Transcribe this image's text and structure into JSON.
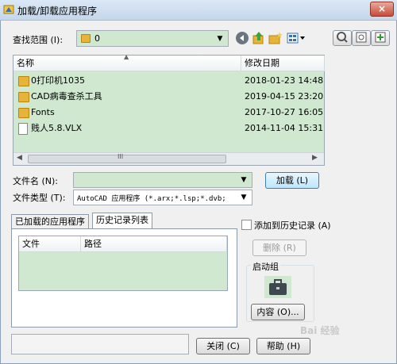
{
  "window": {
    "title": "加载/卸载应用程序",
    "close_label": "×"
  },
  "lookin": {
    "label": "查找范围 (I):",
    "value": "0"
  },
  "toolbar": {
    "icons": [
      "back-icon",
      "up-folder-icon",
      "new-folder-icon",
      "views-icon"
    ]
  },
  "sidebar_buttons": [
    "find-icon",
    "search-icon",
    "add-icon"
  ],
  "file_list": {
    "col_name": "名称",
    "col_date": "修改日期",
    "rows": [
      {
        "name": "0打印机1035",
        "date": "2018-01-23 14:48",
        "type": "folder"
      },
      {
        "name": "CAD病毒查杀工具",
        "date": "2019-04-15 23:20",
        "type": "folder"
      },
      {
        "name": "Fonts",
        "date": "2017-10-27 16:05",
        "type": "folder"
      },
      {
        "name": "贱人5.8.VLX",
        "date": "2014-11-04 15:31",
        "type": "file"
      }
    ],
    "scroll_grip": "III"
  },
  "filename": {
    "label": "文件名 (N):",
    "value": ""
  },
  "filetype": {
    "label": "文件类型 (T):",
    "value": "AutoCAD 应用程序 (*.arx;*.lsp;*.dvb;"
  },
  "buttons": {
    "load": "加载 (L)",
    "unload": "删除 (R)",
    "contents": "内容 (O)...",
    "close": "关闭 (C)",
    "help": "帮助 (H)"
  },
  "tabs": {
    "loaded": "已加载的应用程序",
    "history": "历史记录列表"
  },
  "history_list": {
    "col_file": "文件",
    "col_path": "路径"
  },
  "add_history": {
    "label": "添加到历史记录 (A)",
    "checked": false
  },
  "startup_group": {
    "label": "启动组"
  },
  "status": {
    "text": ""
  },
  "watermark": "Bai 经验"
}
